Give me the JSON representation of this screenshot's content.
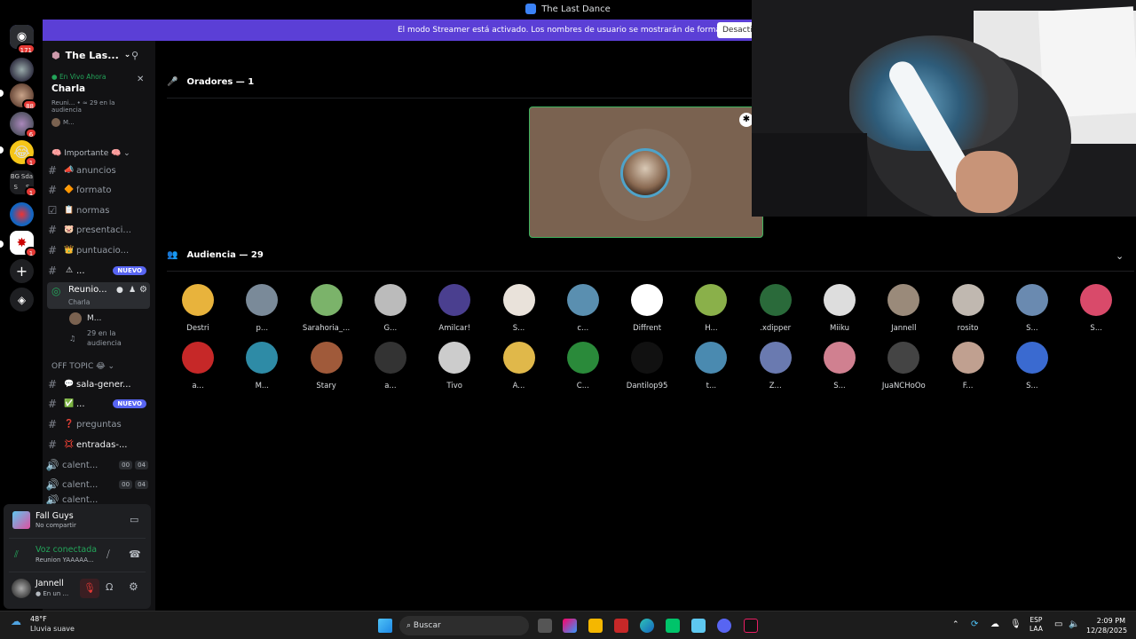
{
  "window": {
    "title": "The Last Dance"
  },
  "banner": {
    "text": "El modo Streamer está activado. Los nombres de usuario se mostrarán de forma parcial.",
    "button": "Desacti"
  },
  "rail": {
    "home_badge": "171",
    "badges": [
      "88",
      "6",
      "1",
      "1",
      "1"
    ],
    "folder_label_1": "BG",
    "folder_label_2": "Sda",
    "folder_s": "S",
    "folder_s2": "S"
  },
  "guild": {
    "name": "The Las..."
  },
  "stage": {
    "live_label": "En Vivo Ahora",
    "title": "Charla",
    "meta": "Reuni... • ≈ 29 en la audiencia",
    "user": "M..."
  },
  "categories": {
    "important": "Importante",
    "offtopic": "OFF TOPIC"
  },
  "channels": [
    {
      "name": "anuncios",
      "emoji": "📣"
    },
    {
      "name": "formato",
      "emoji": "🔶"
    },
    {
      "name": "normas",
      "emoji": "📋"
    },
    {
      "name": "presentaci...",
      "emoji": "🐷"
    },
    {
      "name": "puntuacio...",
      "emoji": "👑"
    },
    {
      "name": "...",
      "emoji": "⚠",
      "badge": "NUEVO"
    }
  ],
  "stage_channel": {
    "name": "Reunio...",
    "sub": "Charla",
    "member": "M...",
    "audience": "29 en la audiencia"
  },
  "offtopic_channels": [
    {
      "name": "sala-gener...",
      "emoji": "💬"
    },
    {
      "name": "...",
      "emoji": "✅",
      "badge": "NUEVO"
    },
    {
      "name": "preguntas",
      "emoji": "❓"
    },
    {
      "name": "entradas-...",
      "emoji": "💢"
    }
  ],
  "voice_channels": [
    {
      "name": "calent...",
      "a": "00",
      "b": "04"
    },
    {
      "name": "calent...",
      "a": "00",
      "b": "04"
    },
    {
      "name": "calent..."
    }
  ],
  "activity": {
    "game": "Fall Guys",
    "status": "No compartir"
  },
  "voice": {
    "status": "Voz conectada",
    "channel": "Reunion YAAAAA..."
  },
  "user": {
    "name": "Jannell",
    "status": "En un ..."
  },
  "main": {
    "speakers_label": "Oradores — 1",
    "audience_label": "Audiencia — 29"
  },
  "audience_row1": [
    "Destri",
    "p...",
    "Sarahoria_...",
    "G...",
    "Amilcar!",
    "S...",
    "c...",
    "Diffrent",
    "H...",
    ".xdipper",
    "Miiku",
    "Jannell",
    "rosito",
    "S...",
    "S..."
  ],
  "audience_row2": [
    "a...",
    "M...",
    "Stary",
    "a...",
    "Tivo",
    "A...",
    "C...",
    "Dantilop95",
    "t...",
    "Z...",
    "S...",
    "JuaNCHoOo",
    "F...",
    "S..."
  ],
  "taskbar": {
    "weather_temp": "48°F",
    "weather_desc": "Lluvia suave",
    "search": "Buscar",
    "lang1": "ESP",
    "lang2": "LAA",
    "time": "2:09 PM",
    "date": "12/28/2025"
  },
  "colors": {
    "accent": "#5865f2",
    "banner": "#5b3fd6",
    "live": "#23a55a",
    "tile_border": "#3fb35e"
  }
}
